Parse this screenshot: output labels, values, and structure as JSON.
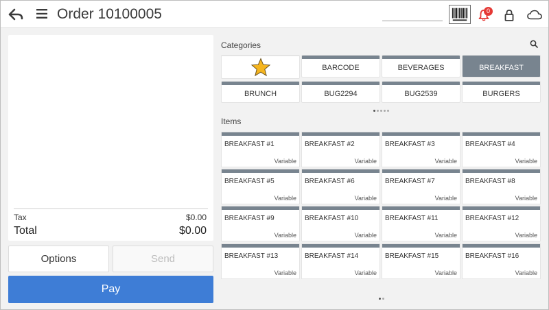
{
  "header": {
    "title": "Order 10100005",
    "notification_count": "0",
    "icons": [
      "back-arrow-icon",
      "hamburger-menu-icon",
      "barcode-icon",
      "bell-icon",
      "lock-icon",
      "cloud-icon"
    ]
  },
  "order": {
    "tax_label": "Tax",
    "tax_value": "$0.00",
    "total_label": "Total",
    "total_value": "$0.00"
  },
  "actions": {
    "options_label": "Options",
    "send_label": "Send",
    "pay_label": "Pay"
  },
  "categories": {
    "label": "Categories",
    "tiles": [
      {
        "label": "",
        "icon": "star-icon"
      },
      {
        "label": "BARCODE"
      },
      {
        "label": "BEVERAGES"
      },
      {
        "label": "BREAKFAST",
        "selected": true
      },
      {
        "label": "BRUNCH"
      },
      {
        "label": "BUG2294"
      },
      {
        "label": "BUG2539"
      },
      {
        "label": "BURGERS"
      }
    ]
  },
  "items": {
    "label": "Items",
    "tiles": [
      {
        "name": "BREAKFAST #1",
        "price": "Variable"
      },
      {
        "name": "BREAKFAST #2",
        "price": "Variable"
      },
      {
        "name": "BREAKFAST #3",
        "price": "Variable"
      },
      {
        "name": "BREAKFAST #4",
        "price": "Variable"
      },
      {
        "name": "BREAKFAST #5",
        "price": "Variable"
      },
      {
        "name": "BREAKFAST #6",
        "price": "Variable"
      },
      {
        "name": "BREAKFAST #7",
        "price": "Variable"
      },
      {
        "name": "BREAKFAST #8",
        "price": "Variable"
      },
      {
        "name": "BREAKFAST #9",
        "price": "Variable"
      },
      {
        "name": "BREAKFAST #10",
        "price": "Variable"
      },
      {
        "name": "BREAKFAST #11",
        "price": "Variable"
      },
      {
        "name": "BREAKFAST #12",
        "price": "Variable"
      },
      {
        "name": "BREAKFAST #13",
        "price": "Variable"
      },
      {
        "name": "BREAKFAST #14",
        "price": "Variable"
      },
      {
        "name": "BREAKFAST #15",
        "price": "Variable"
      },
      {
        "name": "BREAKFAST #16",
        "price": "Variable"
      }
    ]
  },
  "colors": {
    "accent": "#3e7dd6",
    "tile_header": "#78848f",
    "badge": "#e53935",
    "star": "#f5b51e"
  }
}
